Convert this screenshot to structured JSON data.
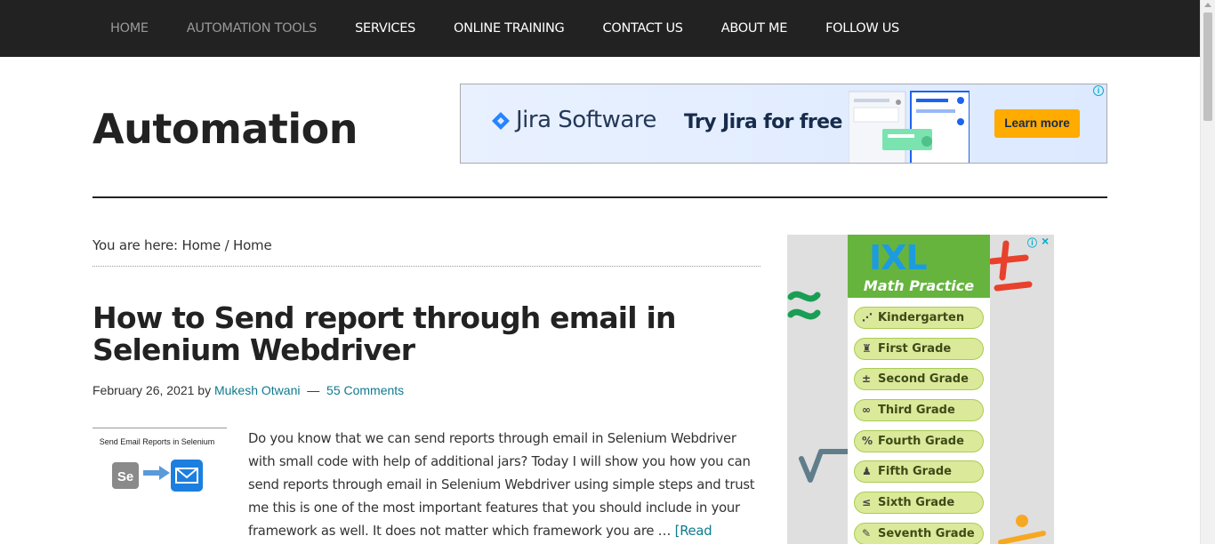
{
  "nav": {
    "items": [
      {
        "label": "HOME"
      },
      {
        "label": "AUTOMATION TOOLS"
      },
      {
        "label": "SERVICES"
      },
      {
        "label": "ONLINE TRAINING"
      },
      {
        "label": "CONTACT US"
      },
      {
        "label": "ABOUT ME"
      },
      {
        "label": "FOLLOW US"
      }
    ]
  },
  "header": {
    "site_title": "Automation"
  },
  "jira_ad": {
    "brand": "Jira Software",
    "tagline": "Try Jira for free",
    "button": "Learn more",
    "brand_color": "#0052cc",
    "button_color": "#ffab00"
  },
  "breadcrumb": {
    "prefix": "You are here:",
    "home": "Home",
    "sep": "/",
    "current": "Home"
  },
  "post": {
    "title": "How to Send report through email in Selenium Webdriver",
    "date": "February 26, 2021",
    "by": "by",
    "author": "Mukesh Otwani",
    "dash": "—",
    "comments": "55 Comments",
    "thumb_caption": "Send Email Reports in Selenium",
    "thumb_logo": "Se",
    "excerpt": "Do you know that we can send reports through email in Selenium Webdriver with small code with help of additional jars? Today I will show you how you can send reports through email in Selenium Webdriver using simple steps and trust me this is one of the most important features that you should include in your framework as well. It does not matter which framework you are … ",
    "read_more": "[Read more...]",
    "link_color": "#0e7a8f"
  },
  "ixl_ad": {
    "logo": "IXL",
    "subtitle": "Math Practice",
    "grades": [
      {
        "label": "Kindergarten",
        "icon": "⋰"
      },
      {
        "label": "First Grade",
        "icon": "♜"
      },
      {
        "label": "Second Grade",
        "icon": "±"
      },
      {
        "label": "Third Grade",
        "icon": "∞"
      },
      {
        "label": "Fourth Grade",
        "icon": "%"
      },
      {
        "label": "Fifth Grade",
        "icon": "♟"
      },
      {
        "label": "Sixth Grade",
        "icon": "≤"
      },
      {
        "label": "Seventh Grade",
        "icon": "✎"
      }
    ]
  }
}
